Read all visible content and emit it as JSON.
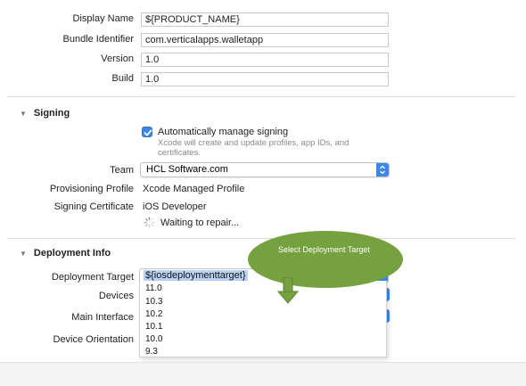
{
  "identity": {
    "display_name_label": "Display Name",
    "display_name_value": "${PRODUCT_NAME}",
    "bundle_id_label": "Bundle Identifier",
    "bundle_id_value": "com.verticalapps.walletapp",
    "version_label": "Version",
    "version_value": "1.0",
    "build_label": "Build",
    "build_value": "1.0"
  },
  "signing": {
    "section_title": "Signing",
    "auto_manage_label": "Automatically manage signing",
    "auto_manage_checked": true,
    "auto_manage_help_line1": "Xcode will create and update profiles, app IDs, and",
    "auto_manage_help_line2": "certificates.",
    "team_label": "Team",
    "team_value": "HCL Software.com",
    "provisioning_label": "Provisioning Profile",
    "provisioning_value": "Xcode Managed Profile",
    "certificate_label": "Signing Certificate",
    "certificate_value": "iOS Developer",
    "status_text": "Waiting to repair..."
  },
  "deployment": {
    "section_title": "Deployment Info",
    "target_label": "Deployment Target",
    "target_value": "${iosdeploymenttarget}",
    "devices_label": "Devices",
    "main_interface_label": "Main Interface",
    "orientation_label": "Device Orientation",
    "target_options": [
      "11.0",
      "10.3",
      "10.2",
      "10.1",
      "10.0",
      "9.3"
    ]
  },
  "annotation": {
    "callout_text": "Select Deployment Target"
  },
  "colors": {
    "accent": "#3b86e6",
    "callout": "#76a13f"
  }
}
